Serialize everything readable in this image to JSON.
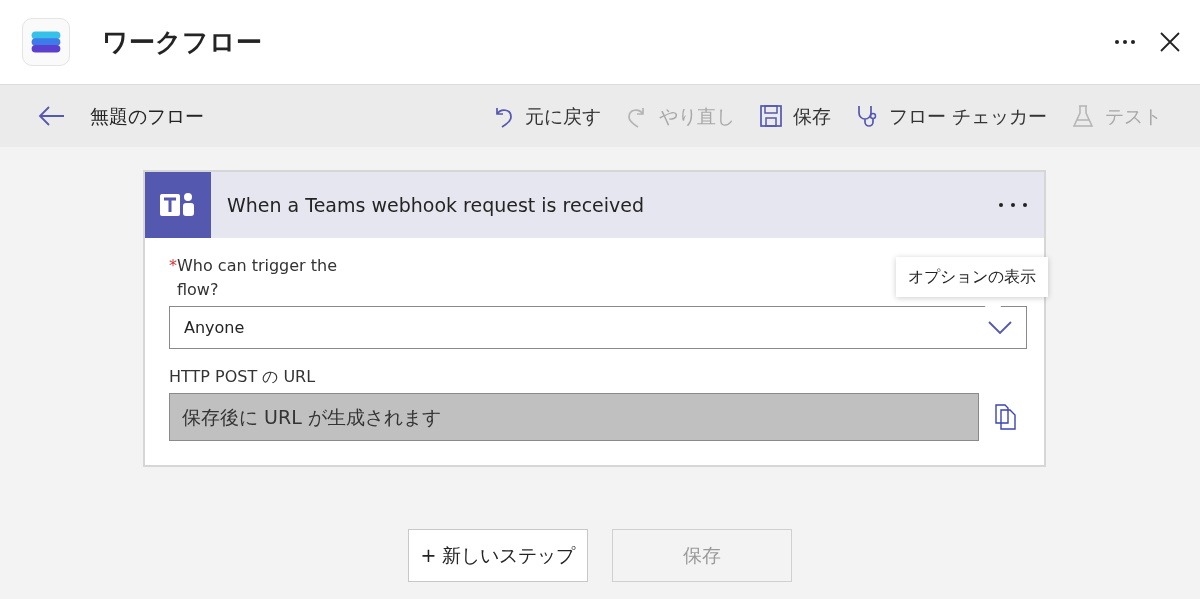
{
  "window": {
    "title": "ワークフロー"
  },
  "toolbar": {
    "back_label": "無題のフロー",
    "actions": [
      {
        "kind": "undo",
        "label": "元に戻す",
        "disabled": false
      },
      {
        "kind": "redo",
        "label": "やり直し",
        "disabled": true
      },
      {
        "kind": "save",
        "label": "保存",
        "disabled": false
      },
      {
        "kind": "checker",
        "label": "フロー チェッカー",
        "disabled": false
      },
      {
        "kind": "test",
        "label": "テスト",
        "disabled": true
      }
    ]
  },
  "trigger_card": {
    "title": "When a Teams webhook request is received",
    "fields": [
      {
        "kind": "dropdown",
        "required_mark": "*",
        "label": "Who can trigger the flow?",
        "value": "Anyone",
        "tooltip": "オプションの表示"
      },
      {
        "kind": "readonly",
        "label": "HTTP POST の URL",
        "value": "保存後に URL が生成されます"
      }
    ]
  },
  "buttons": [
    {
      "label": "+ 新しいステップ",
      "disabled": false
    },
    {
      "label": "保存",
      "disabled": true
    }
  ]
}
